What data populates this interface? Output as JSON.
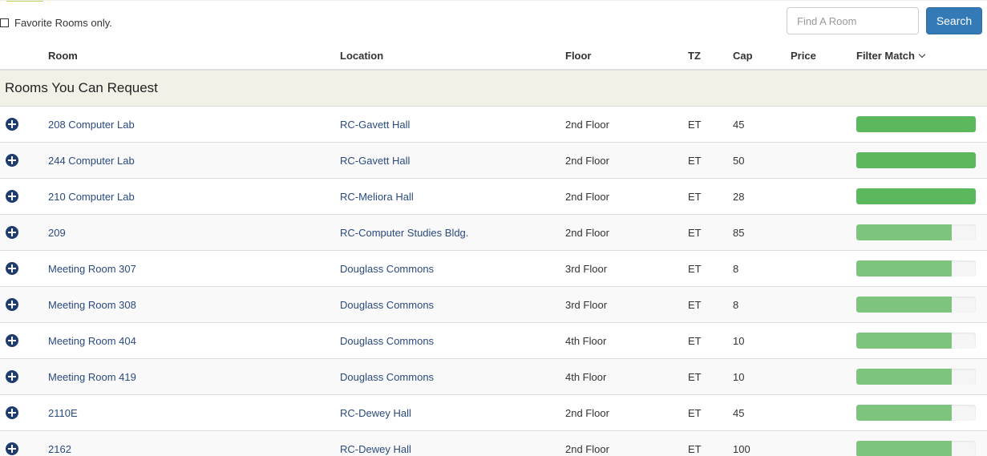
{
  "toolbar": {
    "favorite_label": "Favorite Rooms only.",
    "search_placeholder": "Find A Room",
    "search_button": "Search"
  },
  "columns": {
    "room": "Room",
    "location": "Location",
    "floor": "Floor",
    "tz": "TZ",
    "cap": "Cap",
    "price": "Price",
    "filter_match": "Filter Match"
  },
  "group_title": "Rooms You Can Request",
  "colors": {
    "match_full": "#5cb85c",
    "match_partial": "#7dc57d",
    "link": "#2a4a7f",
    "button": "#337ab7"
  },
  "rows": [
    {
      "room": "208 Computer Lab",
      "location": "RC-Gavett Hall",
      "floor": "2nd Floor",
      "tz": "ET",
      "cap": "45",
      "price": "",
      "match": 1.0
    },
    {
      "room": "244 Computer Lab",
      "location": "RC-Gavett Hall",
      "floor": "2nd Floor",
      "tz": "ET",
      "cap": "50",
      "price": "",
      "match": 1.0
    },
    {
      "room": "210 Computer Lab",
      "location": "RC-Meliora Hall",
      "floor": "2nd Floor",
      "tz": "ET",
      "cap": "28",
      "price": "",
      "match": 1.0
    },
    {
      "room": "209",
      "location": "RC-Computer Studies Bldg.",
      "floor": "2nd Floor",
      "tz": "ET",
      "cap": "85",
      "price": "",
      "match": 0.8
    },
    {
      "room": "Meeting Room 307",
      "location": "Douglass Commons",
      "floor": "3rd Floor",
      "tz": "ET",
      "cap": "8",
      "price": "",
      "match": 0.8
    },
    {
      "room": "Meeting Room 308",
      "location": "Douglass Commons",
      "floor": "3rd Floor",
      "tz": "ET",
      "cap": "8",
      "price": "",
      "match": 0.8
    },
    {
      "room": "Meeting Room 404",
      "location": "Douglass Commons",
      "floor": "4th Floor",
      "tz": "ET",
      "cap": "10",
      "price": "",
      "match": 0.8
    },
    {
      "room": "Meeting Room 419",
      "location": "Douglass Commons",
      "floor": "4th Floor",
      "tz": "ET",
      "cap": "10",
      "price": "",
      "match": 0.8
    },
    {
      "room": "2110E",
      "location": "RC-Dewey Hall",
      "floor": "2nd Floor",
      "tz": "ET",
      "cap": "45",
      "price": "",
      "match": 0.8
    },
    {
      "room": "2162",
      "location": "RC-Dewey Hall",
      "floor": "2nd Floor",
      "tz": "ET",
      "cap": "100",
      "price": "",
      "match": 0.8
    }
  ]
}
